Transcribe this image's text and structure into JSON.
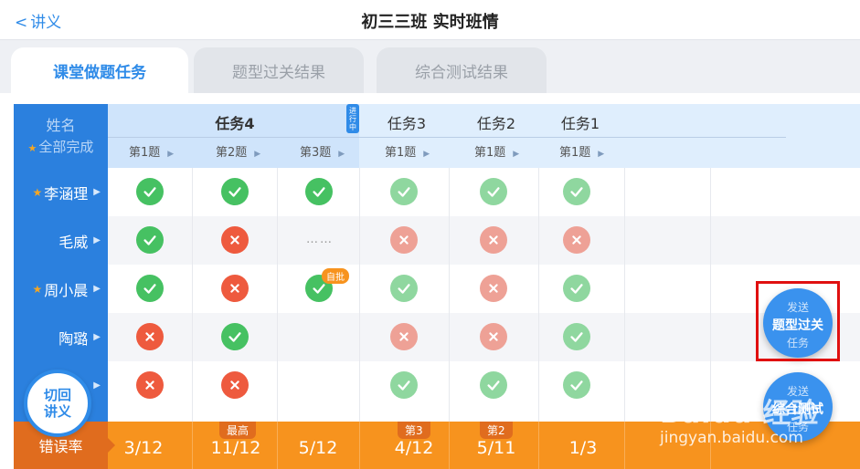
{
  "header": {
    "back_label": "讲义",
    "title": "初三三班 实时班情"
  },
  "tabs": [
    {
      "label": "课堂做题任务",
      "active": true
    },
    {
      "label": "题型过关结果",
      "active": false
    },
    {
      "label": "综合测试结果",
      "active": false
    }
  ],
  "table": {
    "name_header": "姓名",
    "all_done_label": "全部完成",
    "tasks": [
      {
        "label": "任务4",
        "status": "进行中"
      },
      {
        "label": "任务3"
      },
      {
        "label": "任务2"
      },
      {
        "label": "任务1"
      }
    ],
    "sub_columns": [
      "第1题",
      "第2题",
      "第3题",
      "第1题",
      "第1题",
      "第1题"
    ],
    "students": [
      {
        "name": "李涵理",
        "starred": true,
        "marks": [
          "ok",
          "ok",
          "ok",
          "ok-light",
          "ok-light",
          "ok-light"
        ]
      },
      {
        "name": "毛威",
        "starred": false,
        "marks": [
          "ok",
          "no",
          "pending",
          "no-light",
          "no-light",
          "no-light"
        ]
      },
      {
        "name": "周小晨",
        "starred": true,
        "marks": [
          "ok",
          "no",
          "ok",
          "ok-light",
          "no-light",
          "ok-light"
        ],
        "self_grade_label": "自批"
      },
      {
        "name": "陶璐",
        "starred": false,
        "marks": [
          "no",
          "ok",
          "",
          "no-light",
          "no-light",
          "ok-light"
        ]
      },
      {
        "name": "",
        "starred": false,
        "marks": [
          "no",
          "no",
          "",
          "ok-light",
          "ok-light",
          "ok-light"
        ]
      }
    ],
    "pending_text": "……"
  },
  "error_rate": {
    "label": "错误率",
    "values": [
      "3/12",
      "11/12",
      "5/12",
      "4/12",
      "5/11",
      "1/3"
    ],
    "tags": [
      "",
      "最高",
      "",
      "第3",
      "第2",
      ""
    ]
  },
  "switch_button": {
    "line1": "切回",
    "line2": "讲义"
  },
  "fab_pass": {
    "line1": "发送",
    "line2": "题型过关",
    "line3": "任务"
  },
  "fab_test": {
    "line1": "发送",
    "line2": "综合测试",
    "line3": "任务"
  },
  "watermark": {
    "brand": "Baidu 经验",
    "url": "jingyan.baidu.com"
  },
  "colors": {
    "accent": "#2f8be8",
    "correct": "#46c162",
    "wrong": "#ee5a3e",
    "footer": "#f7931e",
    "highlight": "#e01010"
  }
}
